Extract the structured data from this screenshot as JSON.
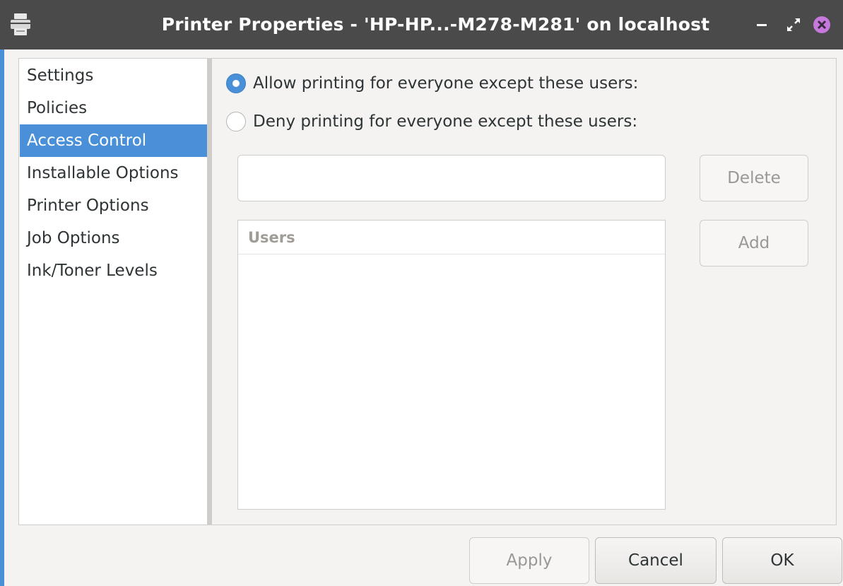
{
  "window": {
    "title": "Printer Properties - 'HP-HP...-M278-M281' on localhost",
    "icon": "printer-icon",
    "controls": {
      "minimize_icon": "minimize-icon",
      "maximize_icon": "maximize-icon",
      "close_icon": "close-icon"
    }
  },
  "sidebar": {
    "items": [
      {
        "label": "Settings",
        "selected": false
      },
      {
        "label": "Policies",
        "selected": false
      },
      {
        "label": "Access Control",
        "selected": true
      },
      {
        "label": "Installable Options",
        "selected": false
      },
      {
        "label": "Printer Options",
        "selected": false
      },
      {
        "label": "Job Options",
        "selected": false
      },
      {
        "label": "Ink/Toner Levels",
        "selected": false
      }
    ]
  },
  "access_control": {
    "allow_label": "Allow printing for everyone except these users:",
    "allow_selected": true,
    "deny_label": "Deny printing for everyone except these users:",
    "deny_selected": false,
    "user_entry_value": "",
    "delete_label": "Delete",
    "add_label": "Add",
    "users_header": "Users",
    "users": []
  },
  "footer": {
    "apply_label": "Apply",
    "cancel_label": "Cancel",
    "ok_label": "OK"
  },
  "colors": {
    "accent": "#4a90d9",
    "titlebar": "#4a4a4a",
    "close": "#c678dd"
  }
}
